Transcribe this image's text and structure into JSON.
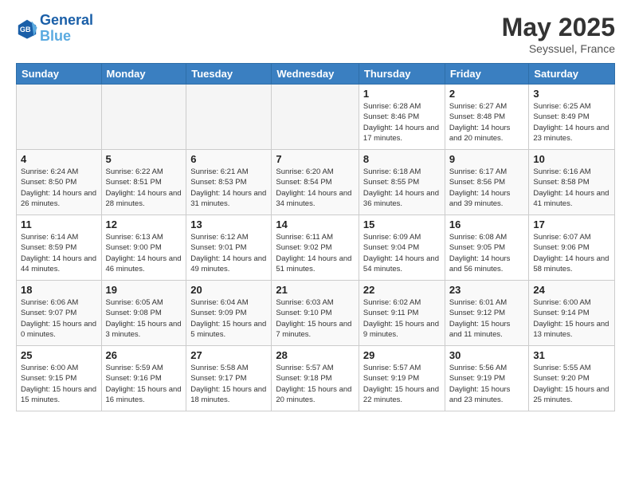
{
  "header": {
    "logo_line1": "General",
    "logo_line2": "Blue",
    "title": "May 2025",
    "subtitle": "Seyssuel, France"
  },
  "days_of_week": [
    "Sunday",
    "Monday",
    "Tuesday",
    "Wednesday",
    "Thursday",
    "Friday",
    "Saturday"
  ],
  "weeks": [
    [
      {
        "day": "",
        "info": ""
      },
      {
        "day": "",
        "info": ""
      },
      {
        "day": "",
        "info": ""
      },
      {
        "day": "",
        "info": ""
      },
      {
        "day": "1",
        "info": "Sunrise: 6:28 AM\nSunset: 8:46 PM\nDaylight: 14 hours and 17 minutes."
      },
      {
        "day": "2",
        "info": "Sunrise: 6:27 AM\nSunset: 8:48 PM\nDaylight: 14 hours and 20 minutes."
      },
      {
        "day": "3",
        "info": "Sunrise: 6:25 AM\nSunset: 8:49 PM\nDaylight: 14 hours and 23 minutes."
      }
    ],
    [
      {
        "day": "4",
        "info": "Sunrise: 6:24 AM\nSunset: 8:50 PM\nDaylight: 14 hours and 26 minutes."
      },
      {
        "day": "5",
        "info": "Sunrise: 6:22 AM\nSunset: 8:51 PM\nDaylight: 14 hours and 28 minutes."
      },
      {
        "day": "6",
        "info": "Sunrise: 6:21 AM\nSunset: 8:53 PM\nDaylight: 14 hours and 31 minutes."
      },
      {
        "day": "7",
        "info": "Sunrise: 6:20 AM\nSunset: 8:54 PM\nDaylight: 14 hours and 34 minutes."
      },
      {
        "day": "8",
        "info": "Sunrise: 6:18 AM\nSunset: 8:55 PM\nDaylight: 14 hours and 36 minutes."
      },
      {
        "day": "9",
        "info": "Sunrise: 6:17 AM\nSunset: 8:56 PM\nDaylight: 14 hours and 39 minutes."
      },
      {
        "day": "10",
        "info": "Sunrise: 6:16 AM\nSunset: 8:58 PM\nDaylight: 14 hours and 41 minutes."
      }
    ],
    [
      {
        "day": "11",
        "info": "Sunrise: 6:14 AM\nSunset: 8:59 PM\nDaylight: 14 hours and 44 minutes."
      },
      {
        "day": "12",
        "info": "Sunrise: 6:13 AM\nSunset: 9:00 PM\nDaylight: 14 hours and 46 minutes."
      },
      {
        "day": "13",
        "info": "Sunrise: 6:12 AM\nSunset: 9:01 PM\nDaylight: 14 hours and 49 minutes."
      },
      {
        "day": "14",
        "info": "Sunrise: 6:11 AM\nSunset: 9:02 PM\nDaylight: 14 hours and 51 minutes."
      },
      {
        "day": "15",
        "info": "Sunrise: 6:09 AM\nSunset: 9:04 PM\nDaylight: 14 hours and 54 minutes."
      },
      {
        "day": "16",
        "info": "Sunrise: 6:08 AM\nSunset: 9:05 PM\nDaylight: 14 hours and 56 minutes."
      },
      {
        "day": "17",
        "info": "Sunrise: 6:07 AM\nSunset: 9:06 PM\nDaylight: 14 hours and 58 minutes."
      }
    ],
    [
      {
        "day": "18",
        "info": "Sunrise: 6:06 AM\nSunset: 9:07 PM\nDaylight: 15 hours and 0 minutes."
      },
      {
        "day": "19",
        "info": "Sunrise: 6:05 AM\nSunset: 9:08 PM\nDaylight: 15 hours and 3 minutes."
      },
      {
        "day": "20",
        "info": "Sunrise: 6:04 AM\nSunset: 9:09 PM\nDaylight: 15 hours and 5 minutes."
      },
      {
        "day": "21",
        "info": "Sunrise: 6:03 AM\nSunset: 9:10 PM\nDaylight: 15 hours and 7 minutes."
      },
      {
        "day": "22",
        "info": "Sunrise: 6:02 AM\nSunset: 9:11 PM\nDaylight: 15 hours and 9 minutes."
      },
      {
        "day": "23",
        "info": "Sunrise: 6:01 AM\nSunset: 9:12 PM\nDaylight: 15 hours and 11 minutes."
      },
      {
        "day": "24",
        "info": "Sunrise: 6:00 AM\nSunset: 9:14 PM\nDaylight: 15 hours and 13 minutes."
      }
    ],
    [
      {
        "day": "25",
        "info": "Sunrise: 6:00 AM\nSunset: 9:15 PM\nDaylight: 15 hours and 15 minutes."
      },
      {
        "day": "26",
        "info": "Sunrise: 5:59 AM\nSunset: 9:16 PM\nDaylight: 15 hours and 16 minutes."
      },
      {
        "day": "27",
        "info": "Sunrise: 5:58 AM\nSunset: 9:17 PM\nDaylight: 15 hours and 18 minutes."
      },
      {
        "day": "28",
        "info": "Sunrise: 5:57 AM\nSunset: 9:18 PM\nDaylight: 15 hours and 20 minutes."
      },
      {
        "day": "29",
        "info": "Sunrise: 5:57 AM\nSunset: 9:19 PM\nDaylight: 15 hours and 22 minutes."
      },
      {
        "day": "30",
        "info": "Sunrise: 5:56 AM\nSunset: 9:19 PM\nDaylight: 15 hours and 23 minutes."
      },
      {
        "day": "31",
        "info": "Sunrise: 5:55 AM\nSunset: 9:20 PM\nDaylight: 15 hours and 25 minutes."
      }
    ]
  ]
}
